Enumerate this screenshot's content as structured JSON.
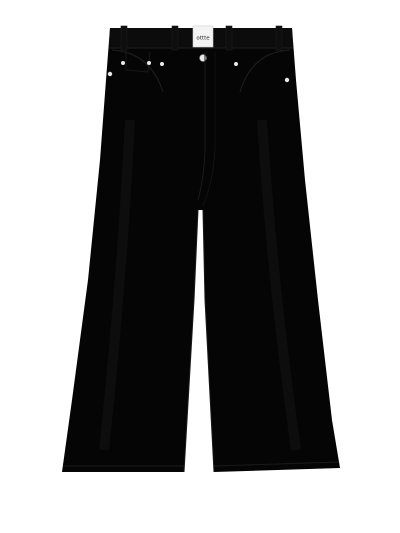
{
  "product": {
    "kind": "wide-leg jeans",
    "colors": {
      "background": "#ffffff",
      "denim": "#050505",
      "denim_highlight": "#121212",
      "seam": "#1b1b1b",
      "hardware": "#e9e9e9",
      "label_fill": "#f4f4f4",
      "label_text": "#222222"
    },
    "label_text": "ottte"
  }
}
